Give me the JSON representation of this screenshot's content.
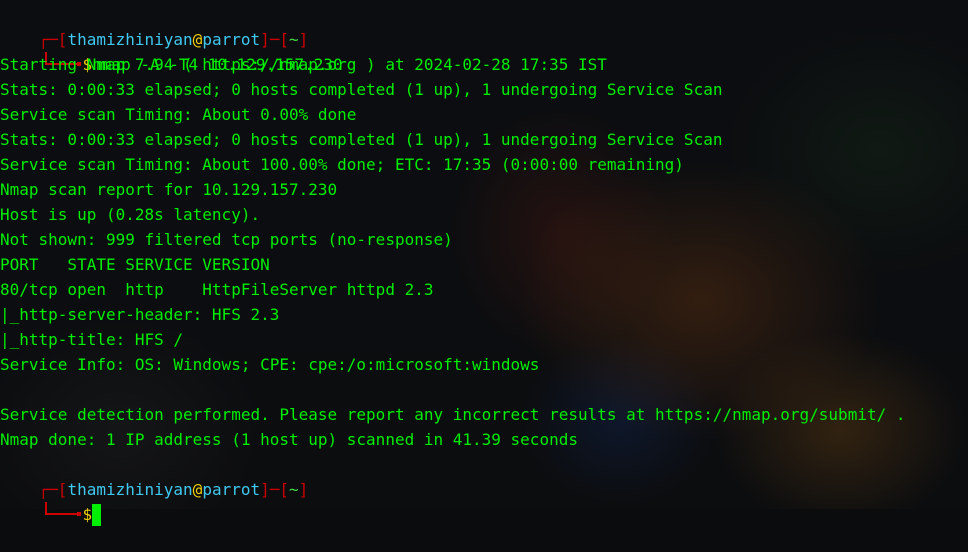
{
  "prompt": {
    "open": "┌─[",
    "user": "thamizhiniyan",
    "at": "@",
    "host": "parrot",
    "sep": "]─[",
    "path": "~",
    "close": "]",
    "dollar": "$"
  },
  "command": "nmap -A -T4 10.129.157.230",
  "output": [
    "Starting Nmap 7.94 ( https://nmap.org ) at 2024-02-28 17:35 IST",
    "Stats: 0:00:33 elapsed; 0 hosts completed (1 up), 1 undergoing Service Scan",
    "Service scan Timing: About 0.00% done",
    "Stats: 0:00:33 elapsed; 0 hosts completed (1 up), 1 undergoing Service Scan",
    "Service scan Timing: About 100.00% done; ETC: 17:35 (0:00:00 remaining)",
    "Nmap scan report for 10.129.157.230",
    "Host is up (0.28s latency).",
    "Not shown: 999 filtered tcp ports (no-response)",
    "PORT   STATE SERVICE VERSION",
    "80/tcp open  http    HttpFileServer httpd 2.3",
    "|_http-server-header: HFS 2.3",
    "|_http-title: HFS /",
    "Service Info: OS: Windows; CPE: cpe:/o:microsoft:windows",
    "",
    "Service detection performed. Please report any incorrect results at https://nmap.org/submit/ .",
    "Nmap done: 1 IP address (1 host up) scanned in 41.39 seconds"
  ],
  "colors": {
    "output_text": "#00ee00",
    "prompt_frame": "#cc0000",
    "user_host": "#3fc8f0",
    "at_dollar": "#f0d000",
    "background": "#0a0c0e"
  }
}
